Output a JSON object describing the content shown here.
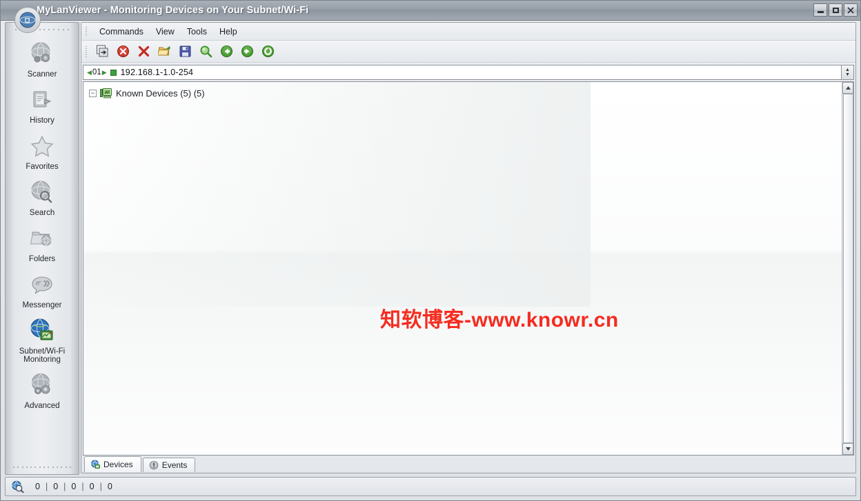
{
  "window": {
    "title": "MyLanViewer - Monitoring Devices on Your Subnet/Wi-Fi",
    "minimize_label": "Minimize",
    "maximize_label": "Maximize",
    "close_label": "✕"
  },
  "sidebar": {
    "items": [
      {
        "label": "Scanner",
        "icon": "globe-scanner-icon",
        "active": false
      },
      {
        "label": "History",
        "icon": "history-document-icon",
        "active": false
      },
      {
        "label": "Favorites",
        "icon": "star-icon",
        "active": false
      },
      {
        "label": "Search",
        "icon": "globe-search-icon",
        "active": false
      },
      {
        "label": "Folders",
        "icon": "folder-globe-icon",
        "active": false
      },
      {
        "label": "Messenger",
        "icon": "speech-bubble-icon",
        "active": false
      },
      {
        "label": "Subnet/Wi-Fi\nMonitoring",
        "icon": "globe-monitor-icon",
        "active": true
      },
      {
        "label": "Advanced",
        "icon": "globe-gear-icon",
        "active": false
      }
    ]
  },
  "menu": {
    "items": [
      {
        "label": "Commands"
      },
      {
        "label": "View"
      },
      {
        "label": "Tools"
      },
      {
        "label": "Help"
      }
    ]
  },
  "toolbar": {
    "buttons": [
      {
        "name": "new-scan-icon",
        "title": "New Scan"
      },
      {
        "name": "stop-icon",
        "title": "Stop"
      },
      {
        "name": "delete-icon",
        "title": "Delete"
      },
      {
        "name": "open-folder-icon",
        "title": "Open"
      },
      {
        "name": "save-icon",
        "title": "Save"
      },
      {
        "name": "find-icon",
        "title": "Find"
      },
      {
        "name": "back-icon",
        "title": "Back"
      },
      {
        "name": "forward-icon",
        "title": "Forward"
      },
      {
        "name": "refresh-icon",
        "title": "Refresh"
      }
    ]
  },
  "range_bar": {
    "prev_arrow": "◀",
    "index": "01",
    "next_arrow": "▶",
    "range_text": "192.168.1-1.0-254",
    "spin_up": "▲",
    "spin_down": "▼"
  },
  "tree": {
    "toggle": "−",
    "root_label": "Known Devices (5) (5)"
  },
  "watermark": {
    "text": "知软博客-www.knowr.cn",
    "color": "#f52c20"
  },
  "tabs": [
    {
      "label": "Devices",
      "icon": "globe-devices-icon",
      "active": true
    },
    {
      "label": "Events",
      "icon": "exclamation-circle-icon",
      "active": false
    }
  ],
  "status_bar": {
    "icon": "globe-magnifier-icon",
    "counts": [
      "0",
      "0",
      "0",
      "0",
      "0"
    ],
    "separator": "|"
  },
  "scrollbar": {
    "up_arrow": "▲",
    "down_arrow": "▼"
  }
}
